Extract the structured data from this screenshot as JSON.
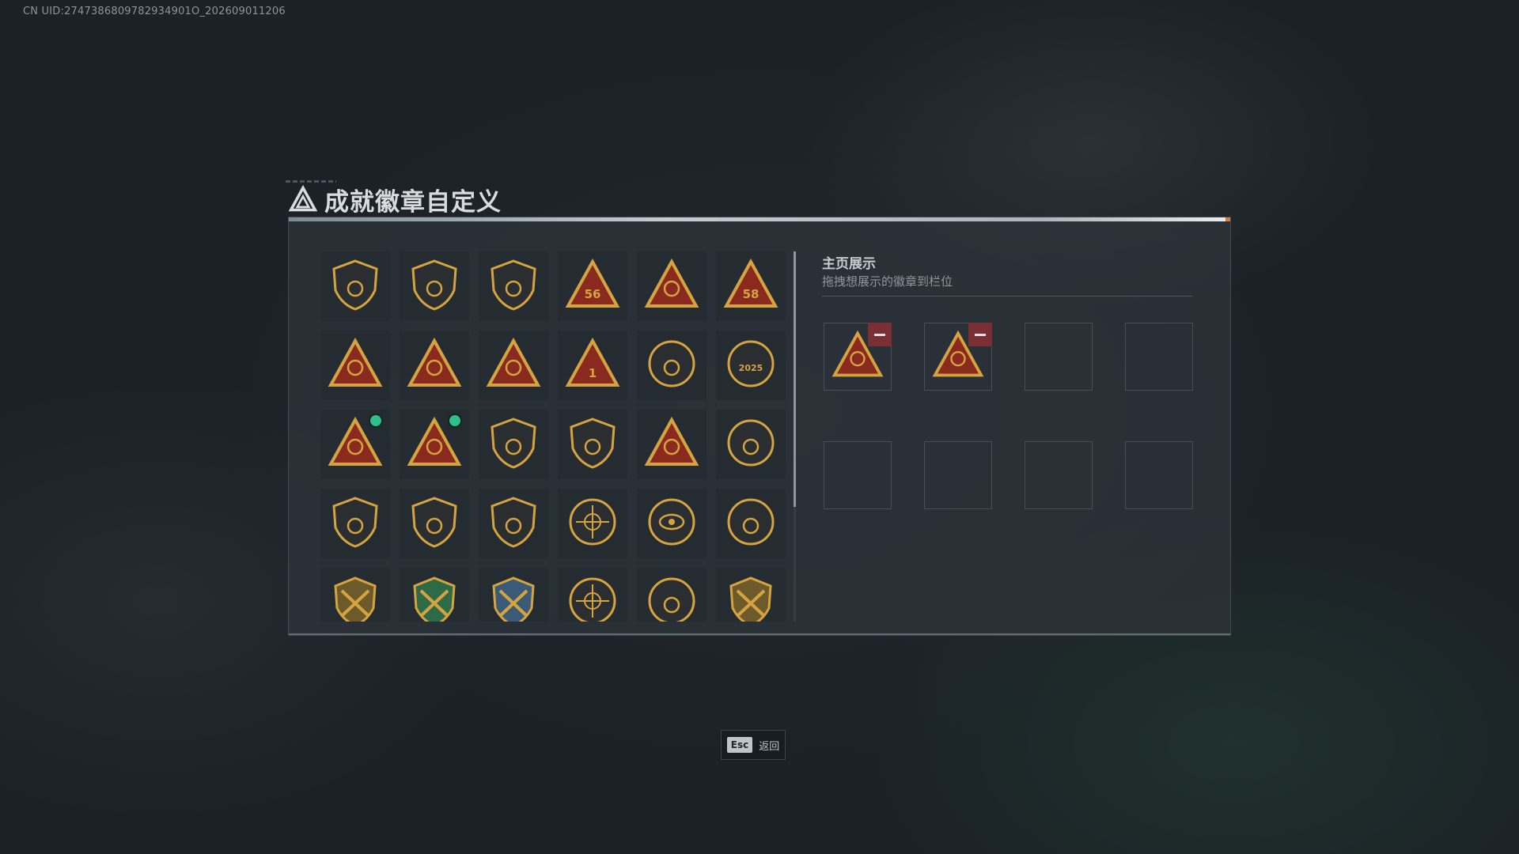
{
  "uid_text": "CN UID:2747386809782934901O_202609011206",
  "page": {
    "title": "成就徽章自定义"
  },
  "colors": {
    "badge_gold": "#d5a441",
    "badge_red": "#8a2a1e",
    "badge_dark": "#2b2e30",
    "new_dot": "#2ec08a",
    "remove_button": "#7a2f34"
  },
  "badges": [
    {
      "icon": "triangle-shield-badge-icon",
      "label": "",
      "new": false
    },
    {
      "icon": "helicopter-badge-icon",
      "label": "",
      "new": false
    },
    {
      "icon": "jet-shield-badge-icon",
      "label": "",
      "new": false
    },
    {
      "icon": "mask-56-badge-icon",
      "label": "56",
      "new": false
    },
    {
      "icon": "radio-badge-icon",
      "label": "",
      "new": false
    },
    {
      "icon": "card-58-badge-icon",
      "label": "58",
      "new": false
    },
    {
      "icon": "turret-badge-icon",
      "label": "",
      "new": false
    },
    {
      "icon": "rock-hand-badge-icon",
      "label": "",
      "new": false
    },
    {
      "icon": "boat-badge-icon",
      "label": "",
      "new": false
    },
    {
      "icon": "number-one-badge-icon",
      "label": "1",
      "new": false
    },
    {
      "icon": "round-emblem-badge-icon",
      "label": "",
      "new": false
    },
    {
      "icon": "year-2025-badge-icon",
      "label": "2025",
      "new": false
    },
    {
      "icon": "backpack-badge-icon",
      "label": "",
      "new": true
    },
    {
      "icon": "soldier-badge-icon",
      "label": "",
      "new": true
    },
    {
      "icon": "shield-core-badge-icon",
      "label": "",
      "new": false
    },
    {
      "icon": "squad-badge-icon",
      "label": "",
      "new": false
    },
    {
      "icon": "rocket-badge-icon",
      "label": "",
      "new": false
    },
    {
      "icon": "star-medal-badge-icon",
      "label": "",
      "new": false
    },
    {
      "icon": "shield-plain-badge-icon",
      "label": "",
      "new": false
    },
    {
      "icon": "shield-stars-gold-badge-icon",
      "label": "",
      "new": false
    },
    {
      "icon": "shield-stars-red-badge-icon",
      "label": "",
      "new": false
    },
    {
      "icon": "crosshair-badge-icon",
      "label": "",
      "new": false
    },
    {
      "icon": "eye-badge-icon",
      "label": "",
      "new": false
    },
    {
      "icon": "flower-badge-icon",
      "label": "",
      "new": false
    },
    {
      "icon": "crossed-rifles-gold-badge-icon",
      "label": "",
      "new": false
    },
    {
      "icon": "crossed-rifles-green-badge-icon",
      "label": "",
      "new": false
    },
    {
      "icon": "crossed-rifles-blue-badge-icon",
      "label": "",
      "new": false
    },
    {
      "icon": "sniper-badge-icon",
      "label": "",
      "new": false
    },
    {
      "icon": "pistol-badge-icon",
      "label": "",
      "new": false
    },
    {
      "icon": "crossed-rifles-gold-2-badge-icon",
      "label": "",
      "new": false
    }
  ],
  "showcase": {
    "title": "主页展示",
    "subtitle": "拖拽想展示的徽章到栏位",
    "slots": [
      {
        "filled": true,
        "icon": "backpack-badge-icon"
      },
      {
        "filled": true,
        "icon": "soldier-badge-icon"
      },
      {
        "filled": false
      },
      {
        "filled": false
      },
      {
        "filled": false
      },
      {
        "filled": false
      },
      {
        "filled": false
      },
      {
        "filled": false
      }
    ]
  },
  "footer": {
    "back_key": "Esc",
    "back_label": "返回"
  },
  "scroll": {
    "visible_fraction": 0.69
  }
}
